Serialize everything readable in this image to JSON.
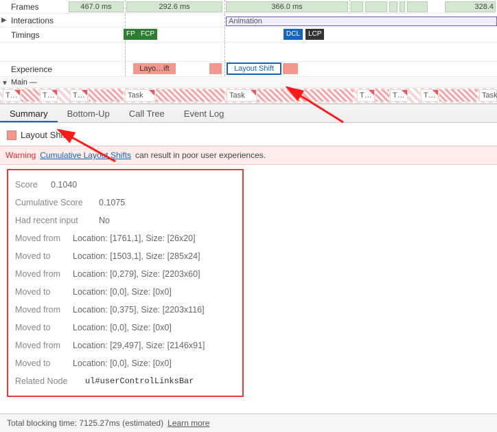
{
  "tracks": {
    "frames_label": "Frames",
    "frames": [
      {
        "text": "467.0 ms"
      },
      {
        "text": "292.6 ms"
      },
      {
        "text": "366.0 ms"
      },
      {
        "text": "328.4"
      }
    ],
    "interactions_label": "Interactions",
    "animation_label": "Animation",
    "timings_label": "Timings",
    "timings": {
      "fp": "FP",
      "fcp": "FCP",
      "dcl": "DCL",
      "lcp": "LCP"
    },
    "experience_label": "Experience",
    "exp_first": "Layo…ift",
    "exp_selected": "Layout Shift",
    "main_label": "Main",
    "task_labels": [
      "T…",
      "T…",
      "T…",
      "Task",
      "Task",
      "T…",
      "T…",
      "T…",
      "Task"
    ]
  },
  "tabs": {
    "summary": "Summary",
    "bottomup": "Bottom-Up",
    "calltree": "Call Tree",
    "eventlog": "Event Log"
  },
  "summary": {
    "title": "Layout Shift",
    "warning_label": "Warning",
    "warning_link": "Cumulative Layout Shifts",
    "warning_rest": " can result in poor user experiences.",
    "rows": [
      {
        "k": "Score",
        "v": "0.1040"
      },
      {
        "k": "Cumulative Score",
        "v": "0.1075"
      },
      {
        "k": "Had recent input",
        "v": "No"
      },
      {
        "k": "Moved from",
        "v": "Location: [1761,1], Size: [26x20]"
      },
      {
        "k": "Moved to",
        "v": "Location: [1503,1], Size: [285x24]"
      },
      {
        "k": "Moved from",
        "v": "Location: [0,279], Size: [2203x60]"
      },
      {
        "k": "Moved to",
        "v": "Location: [0,0], Size: [0x0]"
      },
      {
        "k": "Moved from",
        "v": "Location: [0,375], Size: [2203x116]"
      },
      {
        "k": "Moved to",
        "v": "Location: [0,0], Size: [0x0]"
      },
      {
        "k": "Moved from",
        "v": "Location: [29,497], Size: [2146x91]"
      },
      {
        "k": "Moved to",
        "v": "Location: [0,0], Size: [0x0]"
      }
    ],
    "related_label": "Related Node",
    "related_code": "ul#userControlLinksBar"
  },
  "footer": {
    "text": "Total blocking time: 7125.27ms (estimated)",
    "link": "Learn more"
  }
}
